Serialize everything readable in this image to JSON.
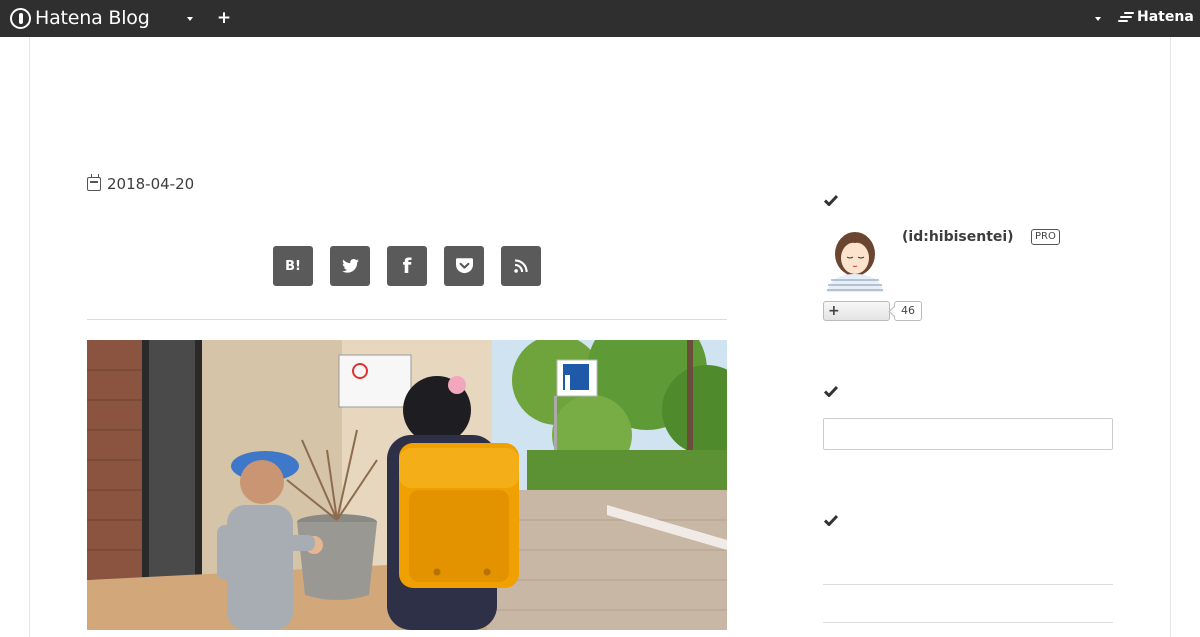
{
  "header": {
    "brand": "Hatena Blog",
    "right_logo": "Hatena",
    "icons": [
      "hatena-blog-logo-icon",
      "chevron-down-icon",
      "plus-icon",
      "chevron-down-icon",
      "hatena-logo-icon"
    ]
  },
  "article": {
    "date": "2018-04-20",
    "share_buttons": [
      {
        "name": "hatena-bookmark",
        "label": "B!"
      },
      {
        "name": "twitter",
        "label": ""
      },
      {
        "name": "facebook",
        "label": "f"
      },
      {
        "name": "pocket",
        "label": ""
      },
      {
        "name": "rss",
        "label": ""
      }
    ]
  },
  "sidebar": {
    "profile": {
      "user_id": "(id:hibisentei)",
      "badge": "PRO",
      "follower_count": "46"
    },
    "search": {
      "placeholder": ""
    }
  },
  "colors": {
    "header_bg": "#2f2f2f",
    "share_button_bg": "#5a5a5a",
    "text": "#3d3d3d"
  }
}
